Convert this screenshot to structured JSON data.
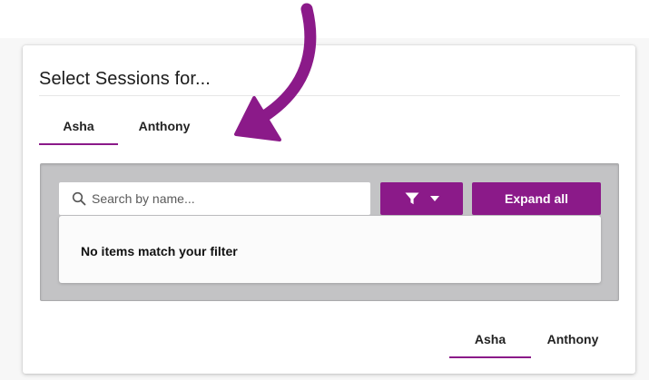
{
  "dialog": {
    "title": "Select Sessions for..."
  },
  "tabs_top": [
    {
      "label": "Asha",
      "active": true
    },
    {
      "label": "Anthony",
      "active": false
    }
  ],
  "search": {
    "placeholder": "Search by name...",
    "value": "",
    "icon": "search-icon"
  },
  "filter_button": {
    "icons": [
      "filter-icon",
      "caret-down-icon"
    ]
  },
  "expand_button": {
    "label": "Expand all"
  },
  "empty_state": {
    "message": "No items match your filter"
  },
  "tabs_bottom": [
    {
      "label": "Asha",
      "active": true
    },
    {
      "label": "Anthony",
      "active": false
    }
  ],
  "colors": {
    "accent": "#8b1a89",
    "panel_bg": "#c3c3c5",
    "arrow": "#8b1a89"
  }
}
